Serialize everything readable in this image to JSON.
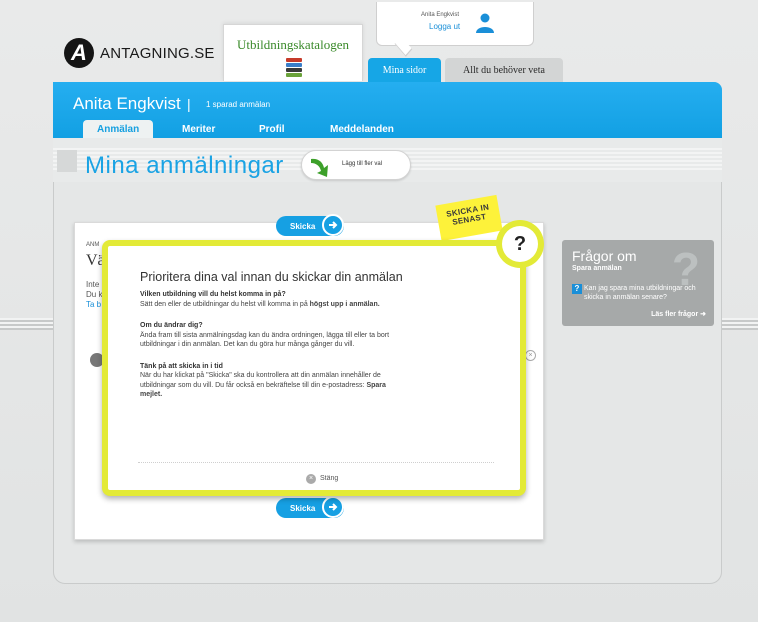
{
  "brand": {
    "logo_letter": "A",
    "name": "ANTAGNING.SE"
  },
  "top_tabs": {
    "catalog": "Utbildningskatalogen",
    "mina_sidor": "Mina sidor",
    "allt": "Allt du behöver veta"
  },
  "user": {
    "name": "Anita Engkvist",
    "logout": "Logga ut"
  },
  "header": {
    "person": "Anita Engkvist",
    "separator": "|",
    "saved": "1 sparad anmälan",
    "nav": [
      "Anmälan",
      "Meriter",
      "Profil",
      "Meddelanden"
    ]
  },
  "page": {
    "title": "Mina anmälningar",
    "add_more": "Lägg till fler val"
  },
  "send_label": "Skicka",
  "sticker": {
    "line1": "SKICKA IN",
    "line2": "SENAST"
  },
  "background_card": {
    "small_header": "ANM",
    "title_fragment": "Vä",
    "line1": "Inte",
    "line2": "Du k",
    "link": "Ta b"
  },
  "faq": {
    "title": "Frågor om",
    "subtitle": "Spara anmälan",
    "question": "Kan jag spara mina utbildningar och skicka in anmälan senare?",
    "more": "Läs fler frågor"
  },
  "modal": {
    "help_symbol": "?",
    "title": "Prioritera dina val innan du skickar din anmälan",
    "sections": [
      {
        "heading": "Vilken utbildning vill du helst komma in på?",
        "text_before": "Sätt den eller de utbildningar du helst vill komma in på ",
        "text_bold": "högst upp i anmälan.",
        "text_after": ""
      },
      {
        "heading": "Om du ändrar dig?",
        "text_before": "Ända fram till sista anmälningsdag kan du ändra ordningen, lägga till eller ta bort utbildningar i din anmälan. Det kan du göra hur många gånger du vill.",
        "text_bold": "",
        "text_after": ""
      },
      {
        "heading": "Tänk på att skicka in i tid",
        "text_before": "När du har klickat på \"Skicka\" ska du kontrollera att din anmälan innehåller de utbildningar som du vill. Du får också en bekräftelse till din e-postadress: ",
        "text_bold": "Spara mejlet.",
        "text_after": ""
      }
    ],
    "close": "Stäng"
  },
  "colors": {
    "accent": "#16a6e6",
    "highlight": "#e3ea37",
    "brand_green": "#3a8a2a"
  }
}
